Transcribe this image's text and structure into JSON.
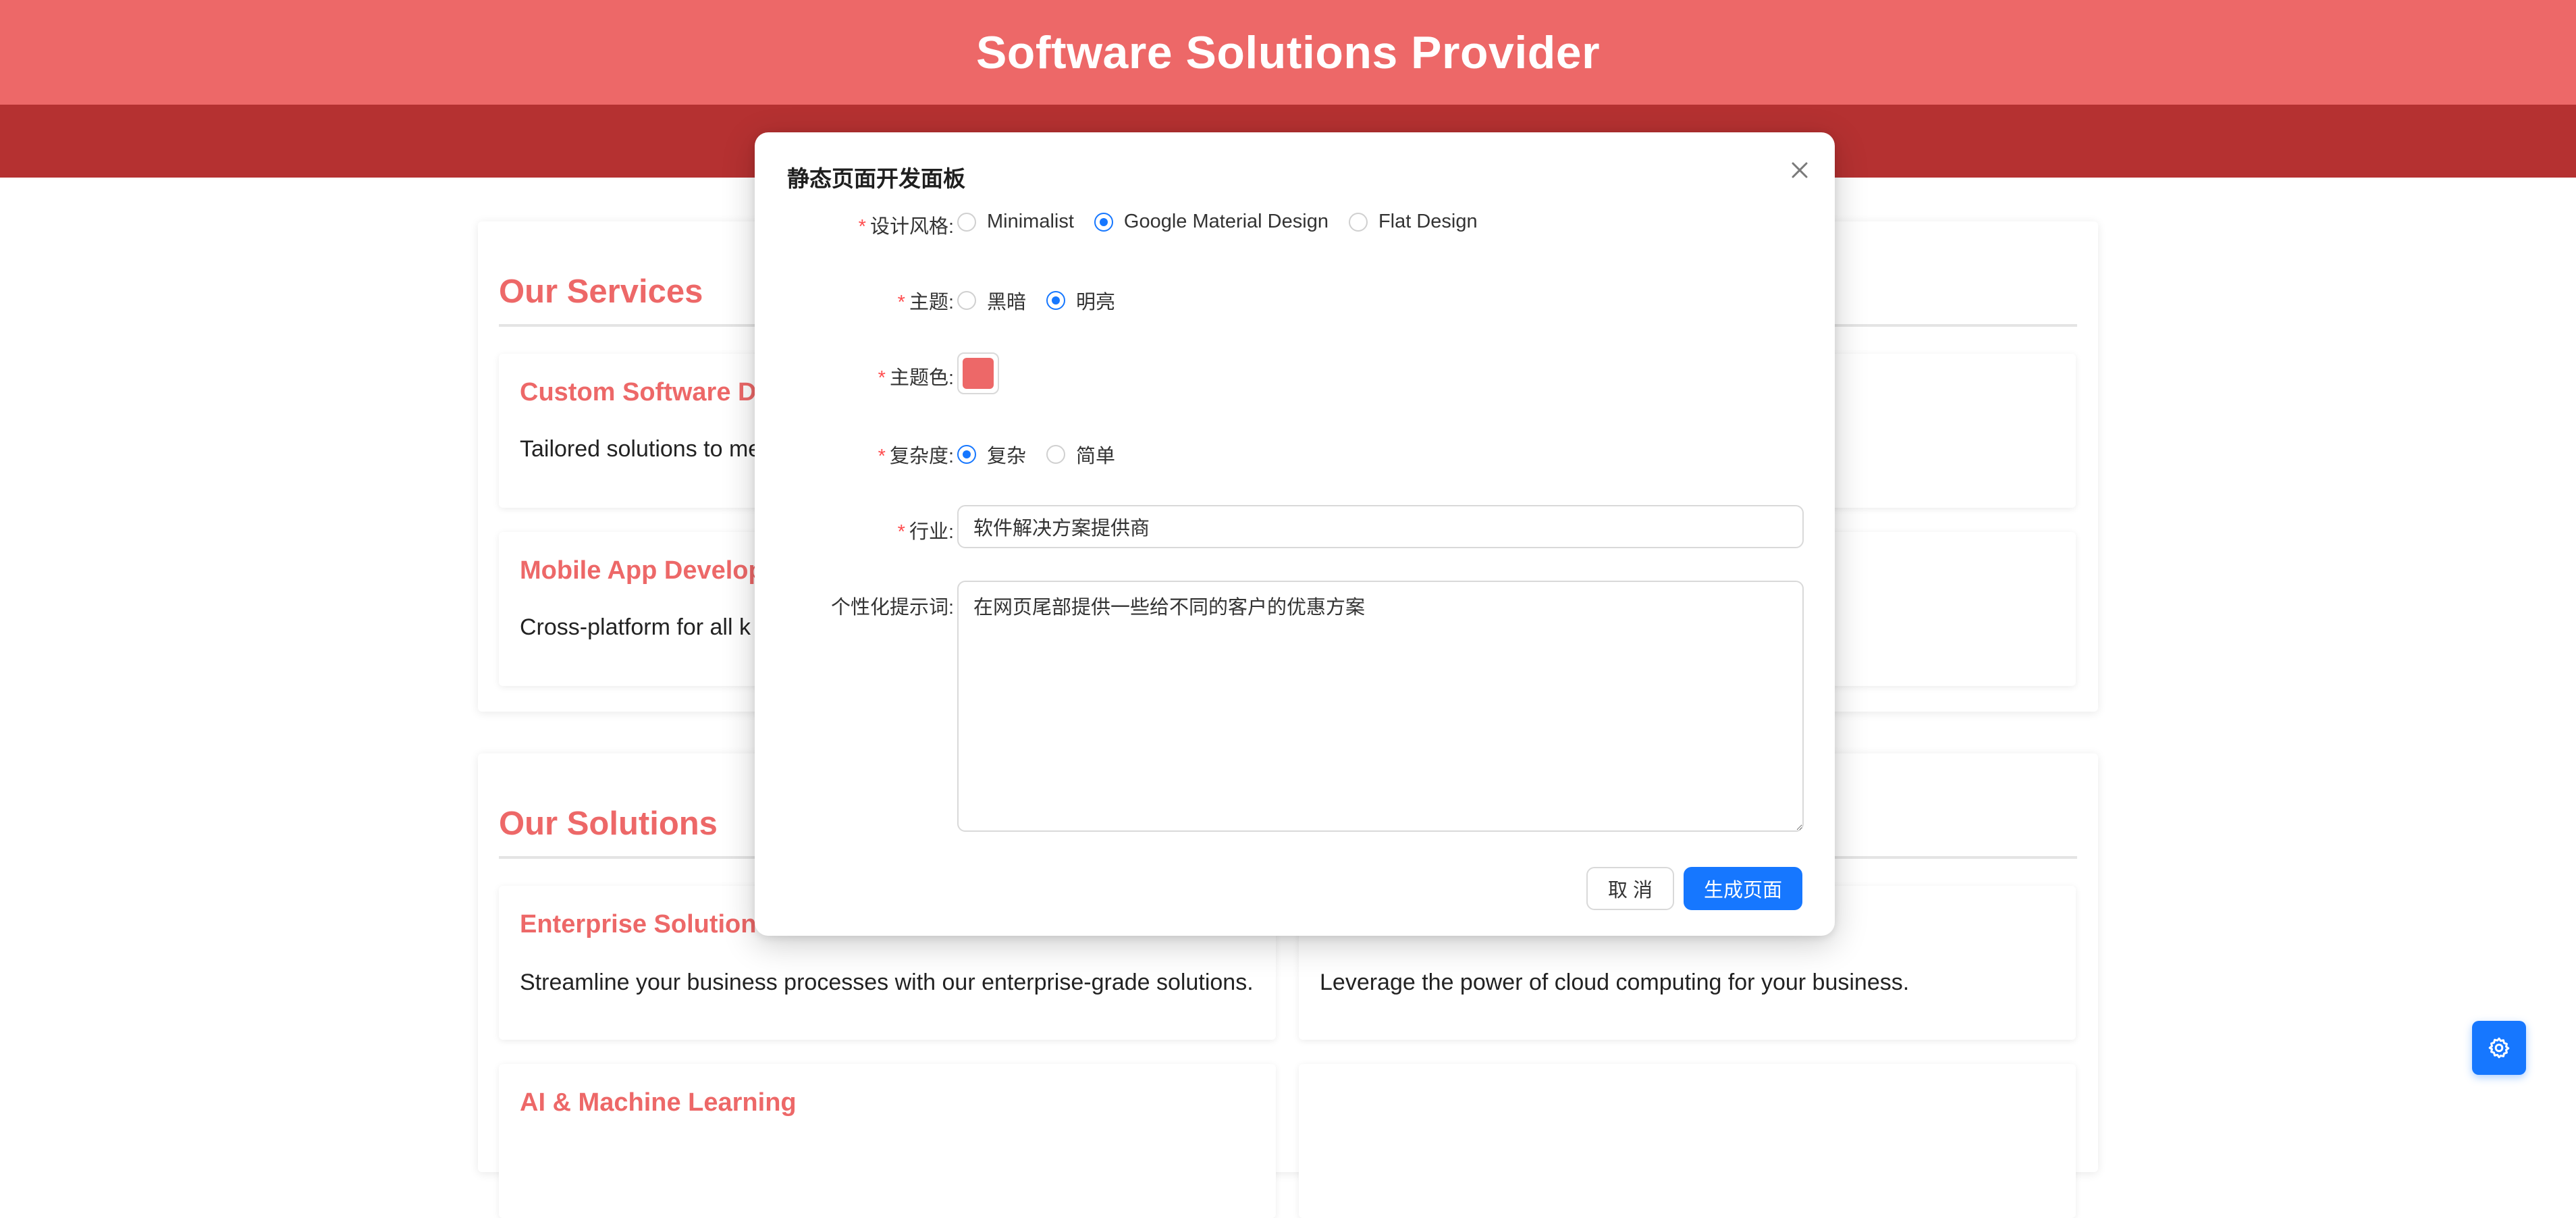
{
  "header": {
    "title": "Software Solutions Provider"
  },
  "services": {
    "title": "Our Services",
    "cards": [
      {
        "title": "Custom Software D",
        "desc": "Tailored solutions to me"
      },
      {
        "title": "Mobile App Develop",
        "desc": "Cross-platform for all k"
      }
    ]
  },
  "solutions": {
    "title": "Our Solutions",
    "cards": [
      {
        "title": "Enterprise Solutions",
        "desc": "Streamline your business processes with our enterprise-grade solutions."
      },
      {
        "title": "",
        "desc": "Leverage the power of cloud computing for your business."
      },
      {
        "title": "AI & Machine Learning",
        "desc": ""
      }
    ]
  },
  "modal": {
    "title": "静态页面开发面板",
    "close_icon": "close-icon",
    "design_style": {
      "label": "设计风格:",
      "options": [
        "Minimalist",
        "Google Material Design",
        "Flat Design"
      ],
      "selected": "Google Material Design"
    },
    "theme": {
      "label": "主题:",
      "options": [
        "黑暗",
        "明亮"
      ],
      "selected": "明亮"
    },
    "theme_color": {
      "label": "主题色:",
      "value": "#ed6868"
    },
    "complexity": {
      "label": "复杂度:",
      "options": [
        "复杂",
        "简单"
      ],
      "selected": "复杂"
    },
    "industry": {
      "label": "行业:",
      "value": "软件解决方案提供商"
    },
    "prompt": {
      "label": "个性化提示词:",
      "value": "在网页尾部提供一些给不同的客户的优惠方案"
    },
    "cancel_label": "取 消",
    "submit_label": "生成页面"
  },
  "fab": {
    "icon": "gear-icon"
  },
  "colors": {
    "primary": "#ed6868",
    "nav": "#b53131",
    "accent": "#1677ff"
  }
}
